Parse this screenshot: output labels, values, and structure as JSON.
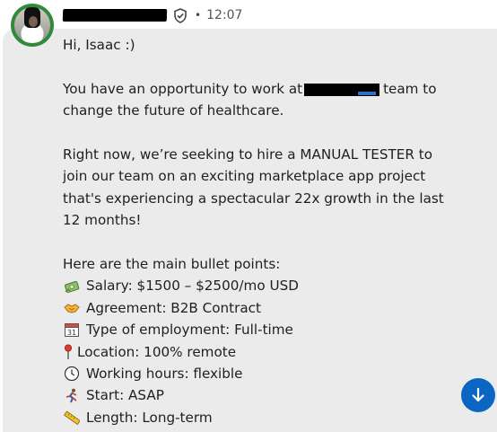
{
  "header": {
    "time": "12:07",
    "separator": "•"
  },
  "message": {
    "greeting": "Hi, Isaac :)",
    "intro_pre": "You have an opportunity to work at",
    "intro_post": "team to",
    "intro_line2": "change the future of healthcare.",
    "p2_line1": "Right now, we’re seeking to hire a MANUAL TESTER to",
    "p2_line2": "join our team on an exciting marketplace app project",
    "p2_line3": "that's experiencing a spectacular 22x growth in the last",
    "p2_line4": "12 months!",
    "bullets_header": "Here are the main bullet points:",
    "bullets": [
      {
        "icon": "money-icon",
        "text": "Salary: $1500 – $2500/mo USD"
      },
      {
        "icon": "handshake-icon",
        "text": "Agreement: B2B Contract"
      },
      {
        "icon": "calendar-icon",
        "text": "Type of employment: Full-time"
      },
      {
        "icon": "pin-icon",
        "text": "Location: 100% remote"
      },
      {
        "icon": "clock-icon",
        "text": "Working hours: flexible"
      },
      {
        "icon": "runner-icon",
        "text": "Start: ASAP"
      },
      {
        "icon": "ruler-icon",
        "text": "Length: Long-term"
      }
    ]
  },
  "calendar_day": "31",
  "colors": {
    "bubble": "#ebebeb",
    "accent": "#0a66c2",
    "avatar_ring": "#2f8a3b"
  }
}
